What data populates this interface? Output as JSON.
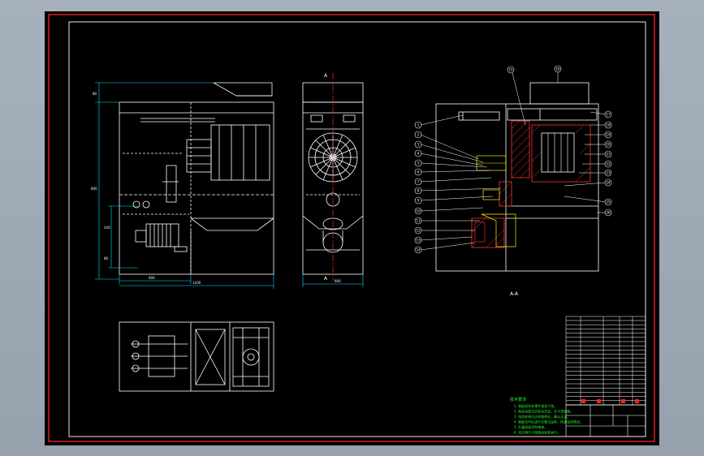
{
  "drawing": {
    "section_mark": "A",
    "section_caption": "A-A",
    "dimensions": {
      "front_top": "80",
      "front_height": "800",
      "front_mid": "240",
      "front_low": "80",
      "front_bottom_a": "600",
      "front_bottom_b": "1200",
      "side_bottom": "600"
    },
    "balloons": [
      "1",
      "2",
      "3",
      "4",
      "5",
      "6",
      "7",
      "8",
      "9",
      "10",
      "11",
      "12",
      "13",
      "14",
      "15",
      "16",
      "17",
      "18",
      "19",
      "20",
      "21",
      "22",
      "23",
      "24",
      "25",
      "26"
    ],
    "notes_title": "技术要求",
    "notes": [
      "1. 装配前所有零件清洗干净。",
      "2. 各转动部位应转动灵活，无卡滞现象。",
      "3. 电机安装后应检查转向，确认无误。",
      "4. 装配完毕后进行空载试运转，检查运转情况。",
      "5. 外露表面涂防锈漆。",
      "6. 未注明尺寸按相关标准执行。"
    ]
  },
  "colors": {
    "background": "#000000",
    "frame": "#ff2222",
    "lines": "#ffffff",
    "dimensions": "#00e5ff",
    "centerline": "#ff2222",
    "notes": "#22ff22",
    "hatch": "#ff3333",
    "parts": "#ffee00"
  }
}
